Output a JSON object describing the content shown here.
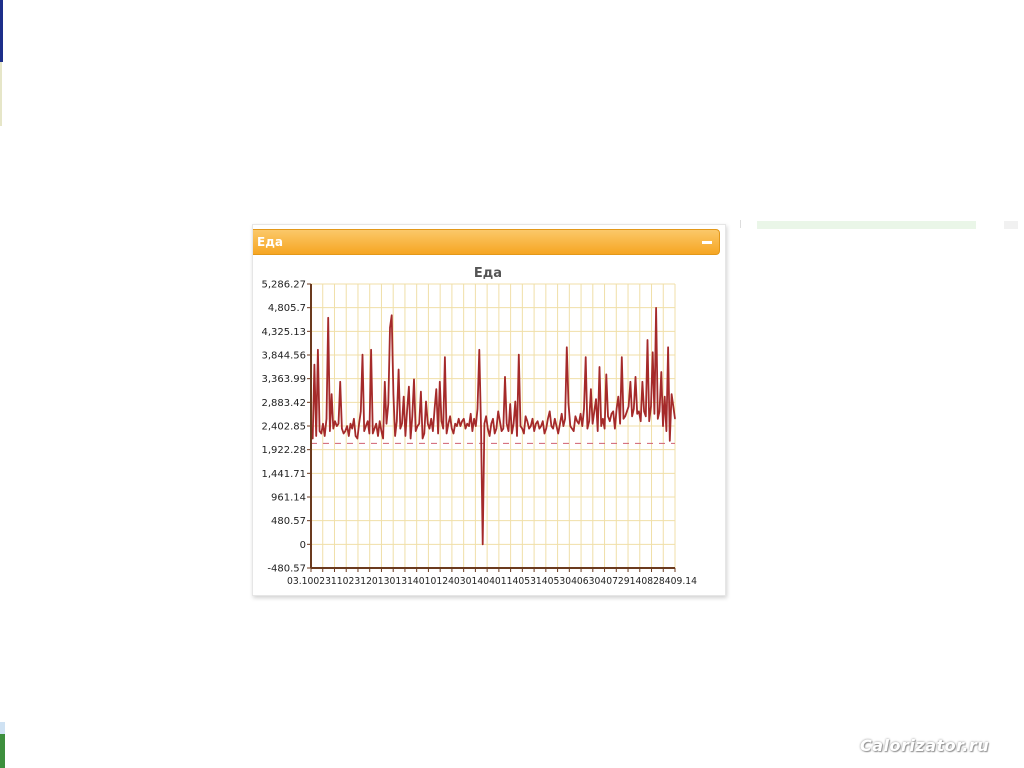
{
  "panel": {
    "title": "Еда"
  },
  "watermark": "Calorizator.ru",
  "colors": {
    "line": "#a52a2a",
    "grid": "#f0dfa8",
    "axis": "#6b3a1e",
    "avg": "#d06070",
    "header": "#f6a623"
  },
  "chart_data": {
    "type": "line",
    "title": "Еда",
    "xlabel": "",
    "ylabel": "",
    "ylim": [
      -480.57,
      5286.27
    ],
    "yticks": [
      "5,286.27",
      "4,805.7",
      "4,325.13",
      "3,844.56",
      "3,363.99",
      "2,883.42",
      "2,402.85",
      "1,922.28",
      "1,441.71",
      "961.14",
      "480.57",
      "0",
      "-480.57"
    ],
    "xticks": [
      "03.10",
      "01.12",
      "31.10",
      "21.12",
      "30.12",
      "31.01",
      "01.02",
      "30.01",
      "21.04",
      "01.05",
      "31.05",
      "31.06",
      "04.07",
      "29.08",
      "28.09.14"
    ],
    "x_label_text": "03.10023110231201301314010124030140401140531405304063040729140828409.14",
    "average": 2050,
    "grid": true,
    "series": [
      {
        "values": [
          2350,
          2150,
          3650,
          2200,
          3950,
          2300,
          2250,
          2450,
          2200,
          2550,
          4600,
          2300,
          3050,
          2350,
          2500,
          2400,
          2450,
          3300,
          2350,
          2250,
          2300,
          2400,
          2200,
          2450,
          2350,
          2550,
          2200,
          2150,
          2450,
          2700,
          3850,
          2300,
          2400,
          2500,
          2250,
          3950,
          2250,
          2350,
          2450,
          2200,
          2500,
          2300,
          2150,
          3300,
          2450,
          2850,
          4400,
          4650,
          3050,
          2200,
          2500,
          3550,
          2350,
          2450,
          3000,
          2200,
          2750,
          3200,
          2150,
          2600,
          3350,
          2300,
          2400,
          2450,
          3100,
          2150,
          2250,
          2900,
          2450,
          2350,
          2550,
          2300,
          2750,
          3150,
          2250,
          3300,
          2500,
          2350,
          3800,
          2250,
          2450,
          2600,
          2350,
          2250,
          2450,
          2400,
          2550,
          2400,
          2500,
          2550,
          2350,
          2450,
          2400,
          2650,
          2300,
          2550,
          2400,
          2750,
          3950,
          2400,
          0,
          2450,
          2600,
          2350,
          2200,
          2450,
          2550,
          2250,
          2350,
          2700,
          2500,
          2300,
          2350,
          3400,
          2450,
          2300,
          2850,
          2250,
          2450,
          2900,
          2200,
          3850,
          2400,
          2350,
          2250,
          2600,
          2500,
          2350,
          2400,
          2550,
          2300,
          2450,
          2500,
          2350,
          2400,
          2500,
          2250,
          2350,
          2550,
          2700,
          2400,
          2350,
          2550,
          2400,
          2250,
          2450,
          2650,
          2400,
          2550,
          4000,
          2850,
          2400,
          2350,
          2300,
          2600,
          2500,
          2450,
          2650,
          2400,
          2750,
          3800,
          2350,
          2500,
          3150,
          2450,
          2700,
          2950,
          2300,
          3600,
          2400,
          2550,
          2350,
          3450,
          2600,
          2500,
          2650,
          2700,
          2350,
          2750,
          3000,
          2450,
          3800,
          2550,
          2600,
          2700,
          2800,
          3300,
          2600,
          2750,
          3400,
          2650,
          2700,
          2500,
          3300,
          2700,
          2600,
          4150,
          2500,
          2800,
          3900,
          2650,
          4800,
          2550,
          2700,
          3500,
          2400,
          3000,
          2300,
          4000,
          2100,
          3050,
          2800,
          2550
        ]
      }
    ]
  }
}
